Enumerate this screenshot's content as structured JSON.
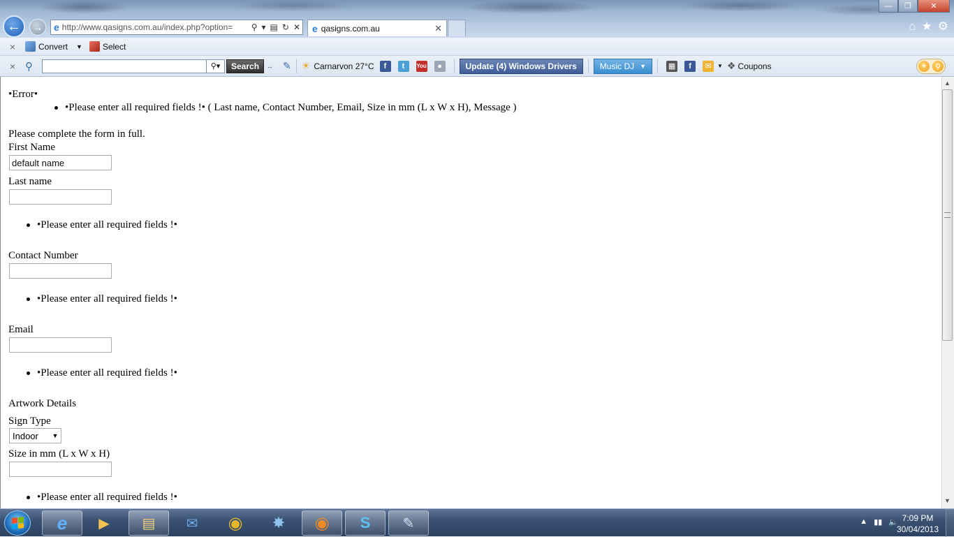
{
  "browser": {
    "address_url": "http://www.qasigns.com.au/index.php?option=",
    "tab_title": "qasigns.com.au"
  },
  "toolbar": {
    "convert_label": "Convert",
    "select_label": "Select"
  },
  "searchbar": {
    "search_button_label": "Search",
    "weather": "Carnarvon 27°C",
    "drivers_button_label": "Update (4) Windows Drivers",
    "musicdj_button_label": "Music DJ",
    "coupons_label": "Coupons"
  },
  "page": {
    "error_title": "•Error•",
    "error_message": "•Please enter all required fields !• ( Last name, Contact Number, Email, Size in mm (L x W x H), Message )",
    "intro_text": "Please complete the form in full.",
    "first_name_label": "First Name",
    "first_name_value": "default name",
    "last_name_label": "Last name",
    "last_name_error": "•Please enter all required fields !•",
    "contact_label": "Contact Number",
    "contact_error": "•Please enter all required fields !•",
    "email_label": "Email",
    "email_error": "•Please enter all required fields !•",
    "artwork_heading": "Artwork Details",
    "sign_type_label": "Sign Type",
    "sign_type_value": "Indoor",
    "size_label": "Size in mm (L x W x H)",
    "size_error": "•Please enter all required fields !•"
  },
  "taskbar": {
    "clock_time": "7:09 PM",
    "clock_date": "30/04/2013"
  },
  "colors": {
    "drivers_button": "#3f5d98",
    "musicdj_button": "#3a8fd0",
    "taskbar": "#3b5273"
  }
}
